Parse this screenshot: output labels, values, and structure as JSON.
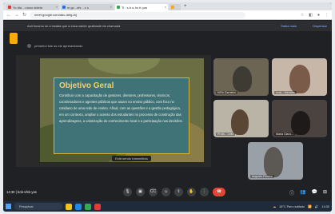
{
  "browser": {
    "tabs": [
      {
        "label": "Yo dla ...rosso sideta",
        "color": "#d33"
      },
      {
        "label": "m.gc...ofs ...c  s",
        "color": "#1a73e8"
      },
      {
        "label": "Ti : s-b-s-ho fr-yas",
        "color": "#34a853"
      },
      {
        "label": "",
        "color": "#f9ab00"
      }
    ],
    "url": "meet.google.com/abc-defg-hij",
    "new_tab_glyph": "+"
  },
  "notice": {
    "text": "Aoli fonsmo se a instala que a essa vainte qualidade da chamada",
    "action1": "Saiba mais",
    "action2": "Dispensar"
  },
  "presenting": {
    "label": "primeirol fole as ele apresentando"
  },
  "slide": {
    "title": "Objetivo Geral",
    "body": "Contribuir com a capacitação de gestores, diretores, professores, técnicos, coordenadores e agentes públicos que atuam no ensino público, com foco no cotidiano de uma rede de ensino. Afinal, com as questões e a gestão pedagógica, em um contexto, ampliar o acesso dos estudantes no processo de construção das aprendizagens, a valorização do conhecimento local e a participação nas decisões."
  },
  "caption": "Está sendo transmitida",
  "tiles": [
    {
      "name": "KiRo Carneiro"
    },
    {
      "name": "Leal... Mendes"
    },
    {
      "name": "Profa... Leite"
    },
    {
      "name": "Maria Clara..."
    },
    {
      "name": "Augusto Pereira"
    }
  ],
  "meeting": {
    "time": "14:30",
    "code": "bob-vfsb-yas"
  },
  "controls": {
    "mic": "🎙",
    "cam": "▣",
    "caption": "CC",
    "emoji": "☺",
    "present": "⇪",
    "raise": "✋",
    "more": "⋮",
    "end": "☎"
  },
  "right_controls": {
    "info": "ⓘ",
    "people": "👥",
    "chat": "💬",
    "activities": "⊞"
  },
  "taskbar": {
    "search": "Pesquisar",
    "weather": "18°C Parc.nublado",
    "time": "14:30"
  }
}
